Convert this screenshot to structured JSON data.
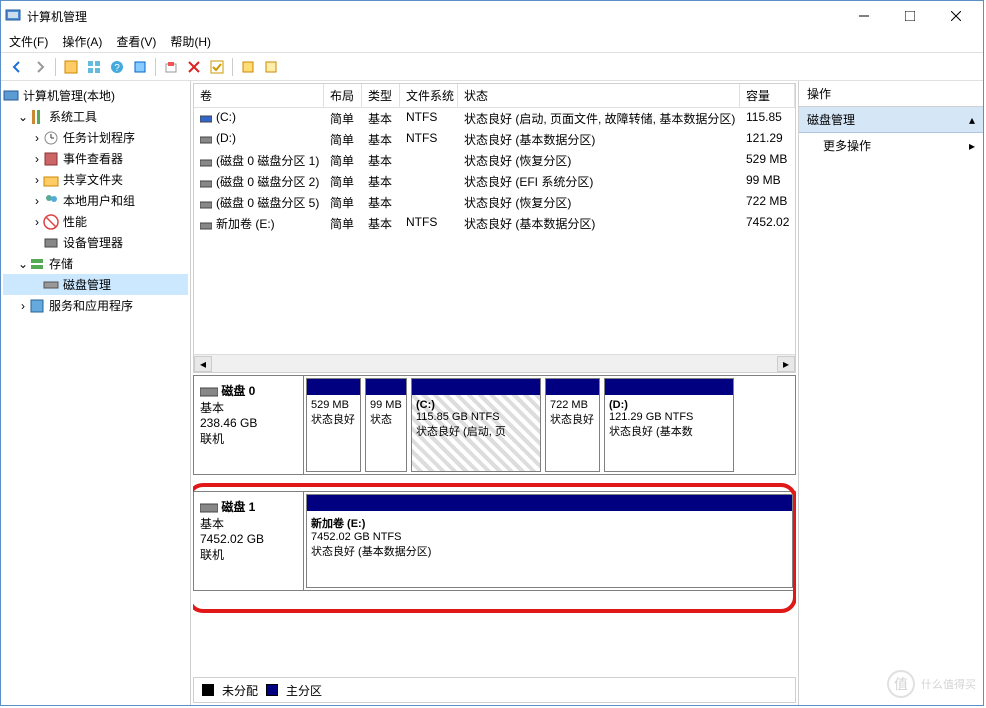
{
  "title": "计算机管理",
  "menu": {
    "file": "文件(F)",
    "action": "操作(A)",
    "view": "查看(V)",
    "help": "帮助(H)"
  },
  "tree": {
    "root": "计算机管理(本地)",
    "sys_tools": "系统工具",
    "task_scheduler": "任务计划程序",
    "event_viewer": "事件查看器",
    "shared_folders": "共享文件夹",
    "local_users": "本地用户和组",
    "performance": "性能",
    "device_manager": "设备管理器",
    "storage": "存储",
    "disk_mgmt": "磁盘管理",
    "services": "服务和应用程序"
  },
  "vcols": {
    "volume": "卷",
    "layout": "布局",
    "type": "类型",
    "fs": "文件系统",
    "status": "状态",
    "capacity": "容量"
  },
  "volumes": [
    {
      "name": "(C:)",
      "layout": "简单",
      "type": "基本",
      "fs": "NTFS",
      "status": "状态良好 (启动, 页面文件, 故障转储, 基本数据分区)",
      "cap": "115.85"
    },
    {
      "name": "(D:)",
      "layout": "简单",
      "type": "基本",
      "fs": "NTFS",
      "status": "状态良好 (基本数据分区)",
      "cap": "121.29"
    },
    {
      "name": "(磁盘 0 磁盘分区 1)",
      "layout": "简单",
      "type": "基本",
      "fs": "",
      "status": "状态良好 (恢复分区)",
      "cap": "529 MB"
    },
    {
      "name": "(磁盘 0 磁盘分区 2)",
      "layout": "简单",
      "type": "基本",
      "fs": "",
      "status": "状态良好 (EFI 系统分区)",
      "cap": "99 MB"
    },
    {
      "name": "(磁盘 0 磁盘分区 5)",
      "layout": "简单",
      "type": "基本",
      "fs": "",
      "status": "状态良好 (恢复分区)",
      "cap": "722 MB"
    },
    {
      "name": "新加卷 (E:)",
      "layout": "简单",
      "type": "基本",
      "fs": "NTFS",
      "status": "状态良好 (基本数据分区)",
      "cap": "7452.02"
    }
  ],
  "disk0": {
    "title": "磁盘 0",
    "type": "基本",
    "size": "238.46 GB",
    "status": "联机",
    "parts": [
      {
        "l1": "",
        "l2": "529 MB",
        "l3": "状态良好"
      },
      {
        "l1": "",
        "l2": "99 MB",
        "l3": "状态"
      },
      {
        "l1": "(C:)",
        "l2": "115.85 GB NTFS",
        "l3": "状态良好 (启动, 页"
      },
      {
        "l1": "",
        "l2": "722 MB",
        "l3": "状态良好"
      },
      {
        "l1": "(D:)",
        "l2": "121.29 GB NTFS",
        "l3": "状态良好 (基本数"
      }
    ]
  },
  "disk1": {
    "title": "磁盘 1",
    "type": "基本",
    "size": "7452.02 GB",
    "status": "联机",
    "part": {
      "l1": "新加卷  (E:)",
      "l2": "7452.02 GB NTFS",
      "l3": "状态良好 (基本数据分区)"
    }
  },
  "legend": {
    "unalloc": "未分配",
    "primary": "主分区"
  },
  "actions": {
    "header": "操作",
    "section": "磁盘管理",
    "more": "更多操作"
  },
  "watermark": "什么值得买"
}
